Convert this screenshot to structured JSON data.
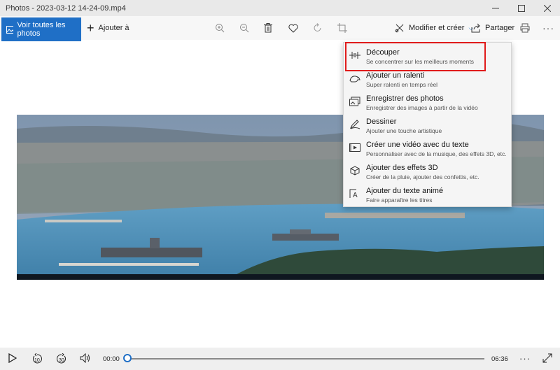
{
  "window": {
    "title": "Photos - 2023-03-12 14-24-09.mp4",
    "minimize_icon": "minimize-icon",
    "maximize_icon": "maximize-icon",
    "close_icon": "close-icon"
  },
  "toolbar": {
    "see_all_label": "Voir toutes les photos",
    "add_to_label": "Ajouter à",
    "modify_label": "Modifier et créer",
    "share_label": "Partager",
    "more_label": "···",
    "accent": "#1f6fc6"
  },
  "menu": {
    "items": [
      {
        "label": "Découper",
        "desc": "Se concentrer sur les meilleurs moments",
        "icon": "trim-icon"
      },
      {
        "label": "Ajouter un ralenti",
        "desc": "Super ralenti en temps réel",
        "icon": "slow-motion-icon"
      },
      {
        "label": "Enregistrer des photos",
        "desc": "Enregistrer des images à partir de la vidéo",
        "icon": "save-photos-icon"
      },
      {
        "label": "Dessiner",
        "desc": "Ajouter une touche artistique",
        "icon": "draw-icon"
      },
      {
        "label": "Créer une vidéo avec du texte",
        "desc": "Personnaliser avec de la musique, des effets 3D, etc.",
        "icon": "video-text-icon"
      },
      {
        "label": "Ajouter des effets 3D",
        "desc": "Créer de la pluie, ajouter des confettis, etc.",
        "icon": "effects-3d-icon"
      },
      {
        "label": "Ajouter du texte animé",
        "desc": "Faire apparaître les titres",
        "icon": "animated-text-icon"
      }
    ],
    "highlight_color": "#e01b1b"
  },
  "player": {
    "current_time": "00:00",
    "total_time": "06:36",
    "rewind_label": "10",
    "forward_label": "30",
    "more_label": "···",
    "progress": 0
  }
}
